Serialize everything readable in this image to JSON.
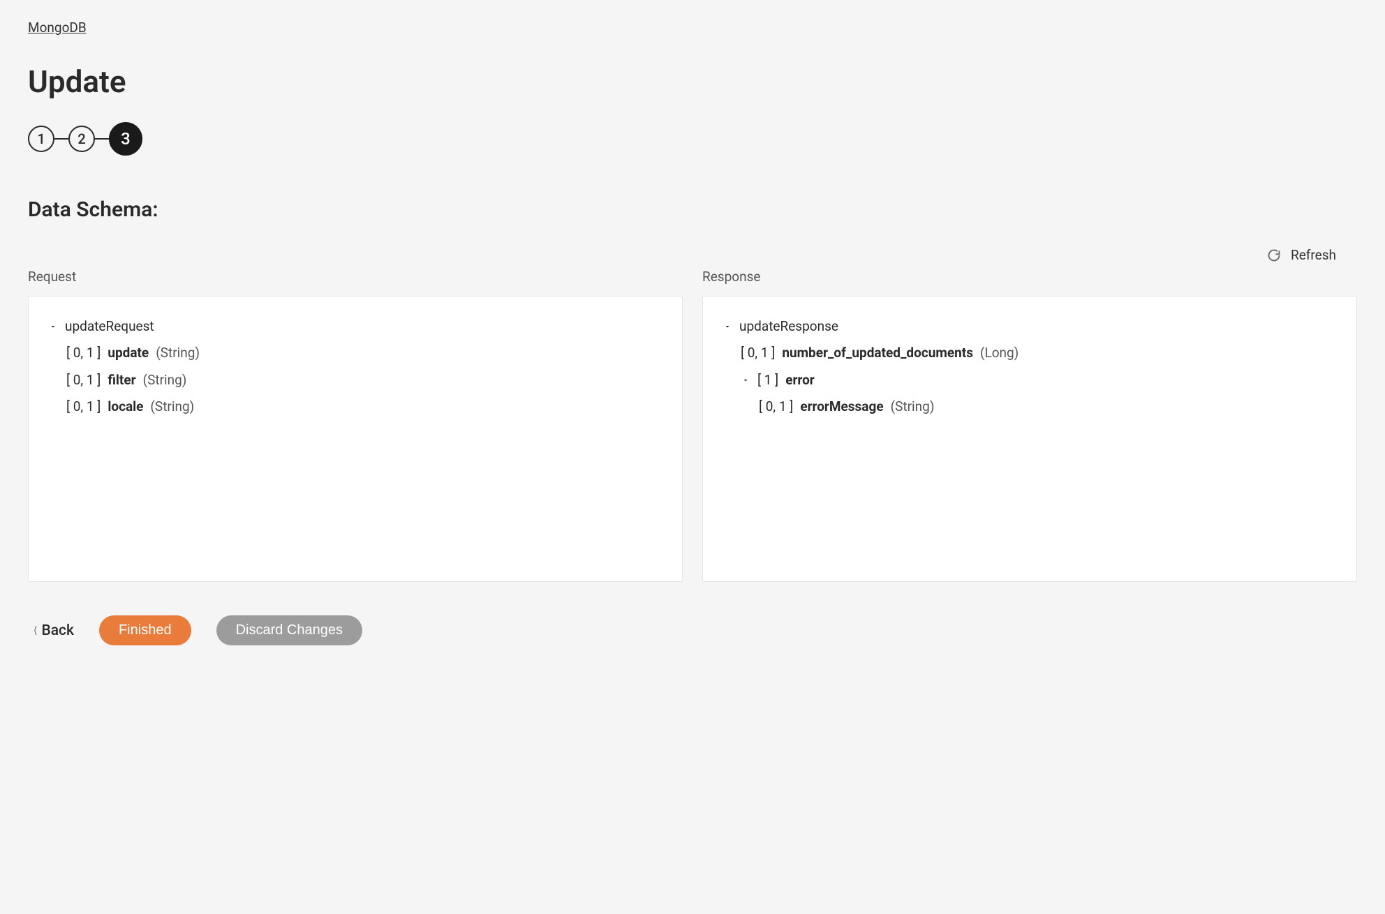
{
  "breadcrumb": "MongoDB",
  "page_title": "Update",
  "stepper": {
    "steps": [
      "1",
      "2",
      "3"
    ],
    "active_index": 2
  },
  "section_heading": "Data Schema:",
  "refresh_label": "Refresh",
  "columns": {
    "request": {
      "label": "Request",
      "root": "updateRequest",
      "fields": [
        {
          "cardinality": "[ 0, 1 ]",
          "name": "update",
          "type": "(String)"
        },
        {
          "cardinality": "[ 0, 1 ]",
          "name": "filter",
          "type": "(String)"
        },
        {
          "cardinality": "[ 0, 1 ]",
          "name": "locale",
          "type": "(String)"
        }
      ]
    },
    "response": {
      "label": "Response",
      "root": "updateResponse",
      "fields": [
        {
          "cardinality": "[ 0, 1 ]",
          "name": "number_of_updated_documents",
          "type": "(Long)"
        }
      ],
      "nested": {
        "cardinality": "[ 1 ]",
        "name": "error",
        "fields": [
          {
            "cardinality": "[ 0, 1 ]",
            "name": "errorMessage",
            "type": "(String)"
          }
        ]
      }
    }
  },
  "footer": {
    "back": "Back",
    "finished": "Finished",
    "discard": "Discard Changes"
  }
}
